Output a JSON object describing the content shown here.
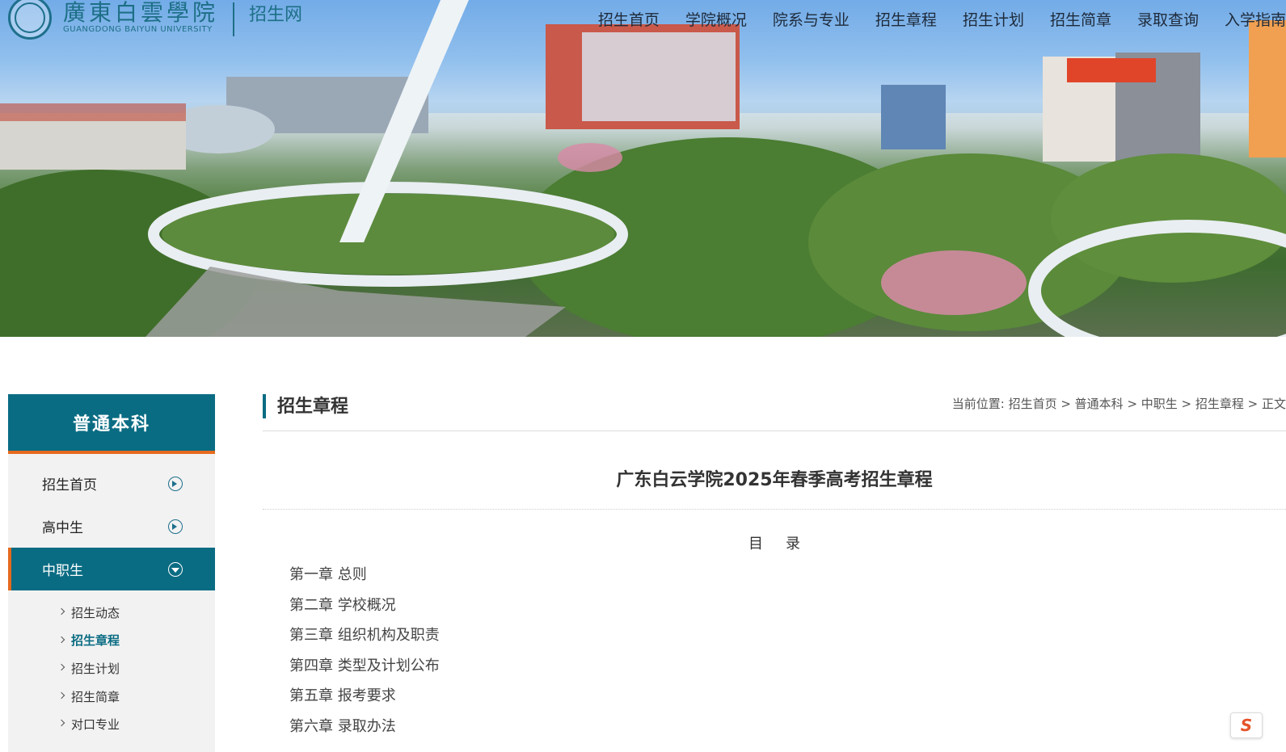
{
  "logo": {
    "name_cn": "廣東白雲學院",
    "name_en": "GUANGDONG BAIYUN UNIVERSITY",
    "site": "招生网"
  },
  "nav": [
    "招生首页",
    "学院概况",
    "院系与专业",
    "招生章程",
    "招生计划",
    "招生简章",
    "录取查询",
    "入学指南"
  ],
  "sidebar": {
    "title": "普通本科",
    "items": [
      {
        "label": "招生首页"
      },
      {
        "label": "高中生"
      },
      {
        "label": "中职生"
      }
    ],
    "sub_items": [
      {
        "label": "招生动态"
      },
      {
        "label": "招生章程"
      },
      {
        "label": "招生计划"
      },
      {
        "label": "招生简章"
      },
      {
        "label": "对口专业"
      }
    ]
  },
  "main": {
    "section_title": "招生章程",
    "breadcrumb": "当前位置: 招生首页 > 普通本科 > 中职生 > 招生章程 > 正文",
    "article_title": "广东白云学院2025年春季高考招生章程",
    "toc_title": "目录",
    "toc": [
      "第一章  总则",
      "第二章  学校概况",
      "第三章  组织机构及职责",
      "第四章  类型及计划公布",
      "第五章  报考要求",
      "第六章  录取办法"
    ]
  },
  "float_button": "S"
}
